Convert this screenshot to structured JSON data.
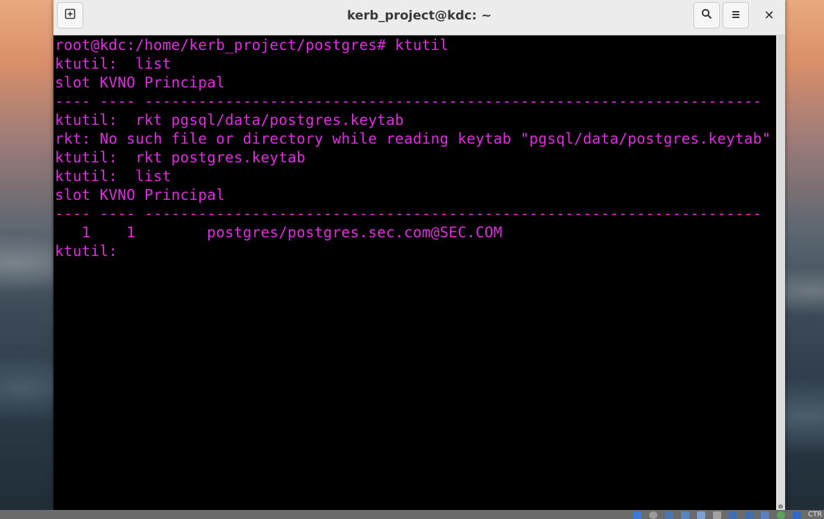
{
  "window": {
    "title": "kerb_project@kdc: ~"
  },
  "titlebar": {
    "new_tab_icon": "new-tab-icon",
    "search_icon": "search-icon",
    "menu_icon": "hamburger-menu-icon",
    "close_glyph": "✕"
  },
  "terminal": {
    "text_color": "#e22ae2",
    "background": "#000000",
    "lines": [
      "root@kdc:/home/kerb_project/postgres# ktutil",
      "ktutil:  list",
      "slot KVNO Principal",
      "---- ---- ---------------------------------------------------------------------",
      "ktutil:  rkt pgsql/data/postgres.keytab",
      "rkt: No such file or directory while reading keytab \"pgsql/data/postgres.keytab\"",
      "ktutil:  rkt postgres.keytab",
      "ktutil:  list",
      "slot KVNO Principal",
      "---- ---- ---------------------------------------------------------------------",
      "   1    1        postgres/postgres.sec.com@SEC.COM",
      "ktutil: "
    ]
  },
  "taskbar": {
    "label": "CTR"
  }
}
